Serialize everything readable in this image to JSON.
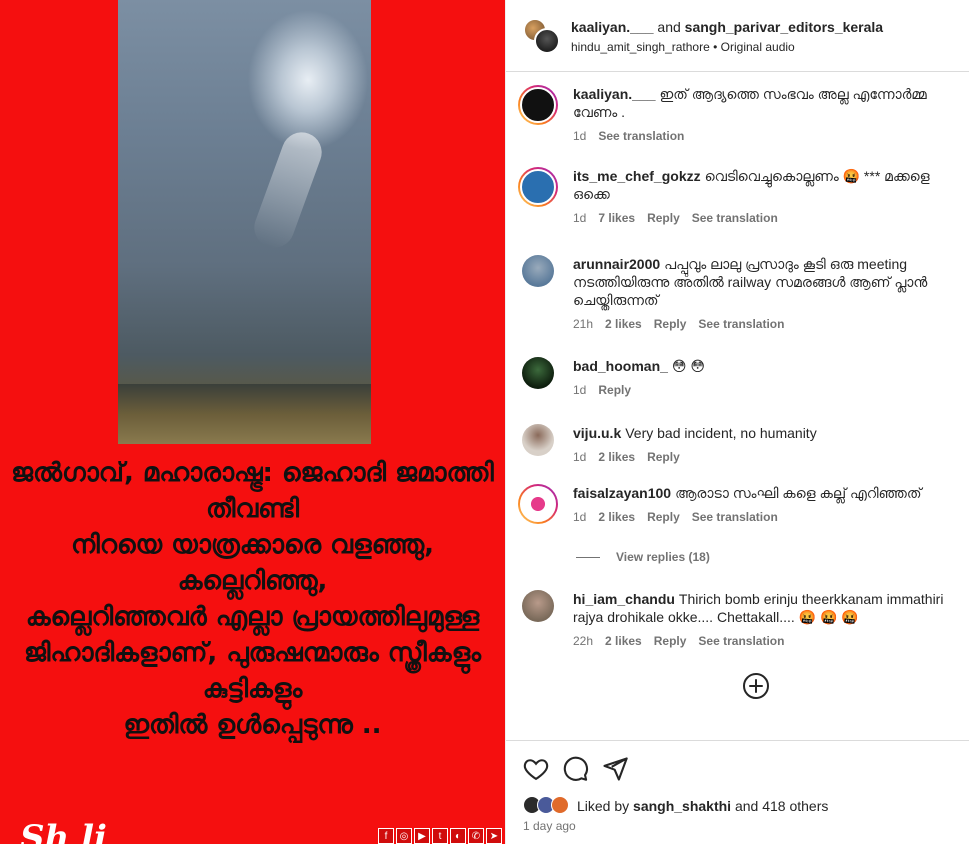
{
  "media": {
    "overlay_text": "ജൽഗാവ്, മഹാരാഷ്ട്ര: ജെഹാദി ജമാത്തി തീവണ്ടി\nനിറയെ യാത്രക്കാരെ വളഞ്ഞു, കല്ലെറിഞ്ഞു,\nകല്ലെറിഞ്ഞവർ എല്ലാ പ്രായത്തിലുമുള്ള\nജിഹാദികളാണ്, പുരുഷന്മാരും സ്ത്രീകളും കുട്ടികളും\nഇതിൽ ഉൾപ്പെടുന്നു ..",
    "watermark": "Sh li",
    "social_icons": [
      "f",
      "◎",
      "▶",
      "t",
      "◐",
      "✆",
      "➤"
    ]
  },
  "header": {
    "user1": "kaaliyan.___",
    "and": "and",
    "user2": "sangh_parivar_editors_kerala",
    "audio_user": "hindu_amit_singh_rathore",
    "audio_sep": "•",
    "audio_label": "Original audio"
  },
  "comments": [
    {
      "user": "kaaliyan.___",
      "text": "ഇത് ആദ്യത്തെ സംഭവം അല്ല എന്നോർമ്മ വേണം .",
      "time": "1d",
      "likes": "",
      "reply": "",
      "translate": "See translation",
      "color": "#111111"
    },
    {
      "user": "its_me_chef_gokzz",
      "text": "വെടിവെച്ചുകൊല്ലണം 🤬 *** മക്കളെ ഒക്കെ",
      "time": "1d",
      "likes": "7 likes",
      "reply": "Reply",
      "translate": "See translation",
      "color": "#2a6fb0"
    },
    {
      "user": "arunnair2000",
      "text": "പപ്പുവും ലാലു പ്രസാദും കൂടി ഒരു meeting നടത്തിയിരുന്നു അതിൽ railway സമരങ്ങൾ ആണ് പ്ലാൻ ചെയ്തിരുന്നത്",
      "time": "21h",
      "likes": "2 likes",
      "reply": "Reply",
      "translate": "See translation",
      "color": "#5a7a9a"
    },
    {
      "user": "bad_hooman_",
      "text": "😳 😳",
      "time": "1d",
      "likes": "",
      "reply": "Reply",
      "translate": "",
      "color": "#1c3a1c"
    },
    {
      "user": "viju.u.k",
      "text": "Very bad incident, no humanity",
      "time": "1d",
      "likes": "2 likes",
      "reply": "Reply",
      "translate": "",
      "color": "#c8b8a8"
    },
    {
      "user": "faisalzayan100",
      "text": "ആരാടാ സംഘി കളെ കല്ല് എറിഞ്ഞത്",
      "time": "1d",
      "likes": "2 likes",
      "reply": "Reply",
      "translate": "See translation",
      "color": "#e63a8a"
    },
    {
      "user": "hi_iam_chandu",
      "text": "Thirich bomb erinju theerkkanam immathiri rajya drohikale okke.... Chettakall.... 🤬 🤬 🤬",
      "time": "22h",
      "likes": "2 likes",
      "reply": "Reply",
      "translate": "See translation",
      "color": "#b89a8a"
    }
  ],
  "view_replies": "View replies (18)",
  "likes": {
    "prefix": "Liked by",
    "user": "sangh_shakthi",
    "suffix": "and 418 others"
  },
  "post_time": "1 day ago"
}
